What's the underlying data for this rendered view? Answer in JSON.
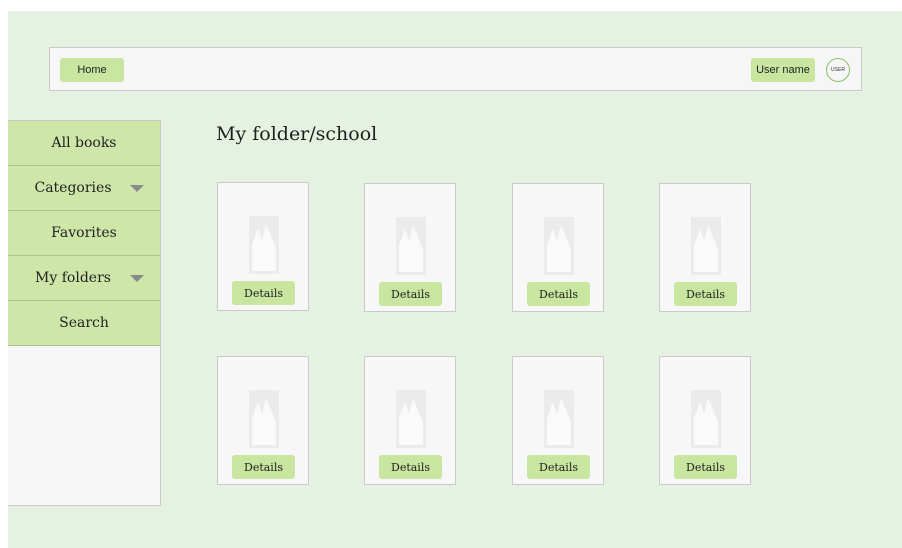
{
  "header": {
    "home_label": "Home",
    "user_name": "User name",
    "avatar_text": "USER"
  },
  "sidebar": {
    "items": [
      {
        "label": "All books",
        "has_dropdown": false
      },
      {
        "label": "Categories",
        "has_dropdown": true
      },
      {
        "label": "Favorites",
        "has_dropdown": false
      },
      {
        "label": "My folders",
        "has_dropdown": true
      },
      {
        "label": "Search",
        "has_dropdown": false
      }
    ]
  },
  "main": {
    "title": "My folder/school",
    "cards": [
      {
        "button": "Details",
        "image": "image-placeholder-icon"
      },
      {
        "button": "Details",
        "image": "image-placeholder-icon"
      },
      {
        "button": "Details",
        "image": "image-placeholder-icon"
      },
      {
        "button": "Details",
        "image": "image-placeholder-icon"
      },
      {
        "button": "Details",
        "image": "image-placeholder-icon"
      },
      {
        "button": "Details",
        "image": "image-placeholder-icon"
      },
      {
        "button": "Details",
        "image": "image-placeholder-icon"
      },
      {
        "button": "Details",
        "image": "image-placeholder-icon"
      }
    ]
  },
  "colors": {
    "background": "#e6f2e1",
    "accent": "#c8e6a0",
    "sidebar_item": "#cfe6a9",
    "panel": "#f6f6f6"
  }
}
